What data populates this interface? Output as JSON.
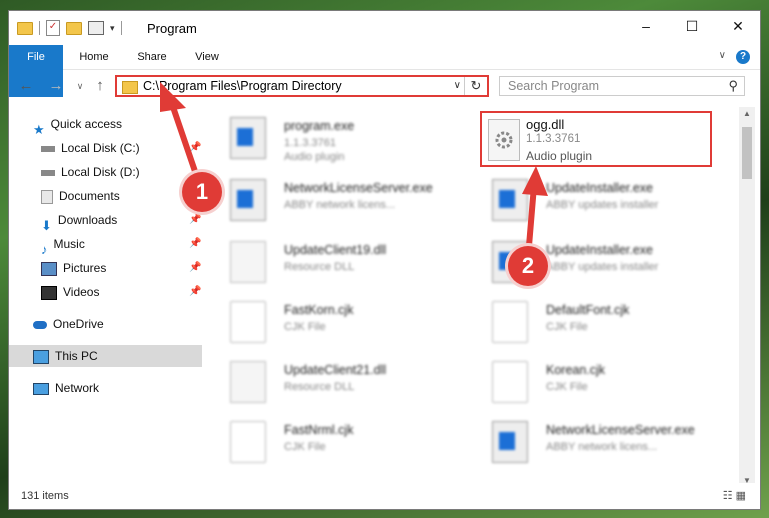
{
  "window": {
    "title": "Program",
    "controls": {
      "minimize": "–",
      "maximize": "☐",
      "close": "✕"
    }
  },
  "ribbon": {
    "tabs": [
      "File",
      "Home",
      "Share",
      "View"
    ],
    "help": "?",
    "chevron": "∨"
  },
  "nav": {
    "back": "←",
    "forward": "→",
    "up": "↑",
    "address": "C:\\Program Files\\Program Directory",
    "address_dropdown": "∨",
    "refresh": "↻",
    "search_placeholder": "Search Program",
    "search_icon": "⚲"
  },
  "sidebar": {
    "items": [
      {
        "label": "Quick access",
        "icon": "star-icon",
        "pinned": false
      },
      {
        "label": "Local Disk (C:)",
        "icon": "drive-icon",
        "pinned": true
      },
      {
        "label": "Local Disk (D:)",
        "icon": "drive-icon",
        "pinned": false
      },
      {
        "label": "Documents",
        "icon": "documents-icon",
        "pinned": true
      },
      {
        "label": "Downloads",
        "icon": "downloads-icon",
        "pinned": true
      },
      {
        "label": "Music",
        "icon": "music-icon",
        "pinned": true
      },
      {
        "label": "Pictures",
        "icon": "pictures-icon",
        "pinned": true
      },
      {
        "label": "Videos",
        "icon": "videos-icon",
        "pinned": true
      },
      {
        "label": "OneDrive",
        "icon": "cloud-icon",
        "pinned": false
      },
      {
        "label": "This PC",
        "icon": "computer-icon",
        "pinned": false,
        "selected": true
      },
      {
        "label": "Network",
        "icon": "network-icon",
        "pinned": false
      }
    ],
    "pin_glyph": "📌"
  },
  "files": [
    {
      "name": "program.exe",
      "line2": "1.1.3.3761",
      "line3": "Audio plugin",
      "icon": "app-icon"
    },
    {
      "name": "ogg.dll",
      "line2": "1.1.3.3761",
      "line3": "Audio plugin",
      "icon": "gear-file-icon",
      "highlighted": true
    },
    {
      "name": "NetworkLicenseServer.exe",
      "line2": "ABBY network licens...",
      "icon": "window-icon"
    },
    {
      "name": "UpdateInstaller.exe",
      "line2": "ABBY updates installer",
      "icon": "window-icon"
    },
    {
      "name": "UpdateClient19.dll",
      "line2": "Resource DLL",
      "icon": "gear-file-icon"
    },
    {
      "name": "UpdateInstaller.exe",
      "line2": "ABBY updates installer",
      "icon": "window-icon"
    },
    {
      "name": "FastKorn.cjk",
      "line2": "CJK File",
      "icon": "file-icon"
    },
    {
      "name": "DefaultFont.cjk",
      "line2": "CJK File",
      "icon": "file-icon"
    },
    {
      "name": "UpdateClient21.dll",
      "line2": "Resource DLL",
      "icon": "gear-file-icon"
    },
    {
      "name": "Korean.cjk",
      "line2": "CJK File",
      "icon": "file-icon"
    },
    {
      "name": "FastNrml.cjk",
      "line2": "CJK File",
      "icon": "file-icon"
    },
    {
      "name": "NetworkLicenseServer.exe",
      "line2": "ABBY network licens...",
      "icon": "window-icon"
    }
  ],
  "status": {
    "count": "131 items",
    "views": "☷ ▦"
  },
  "callouts": [
    "1",
    "2"
  ],
  "colors": {
    "accent": "#1979ca",
    "highlight": "#e03b36"
  }
}
